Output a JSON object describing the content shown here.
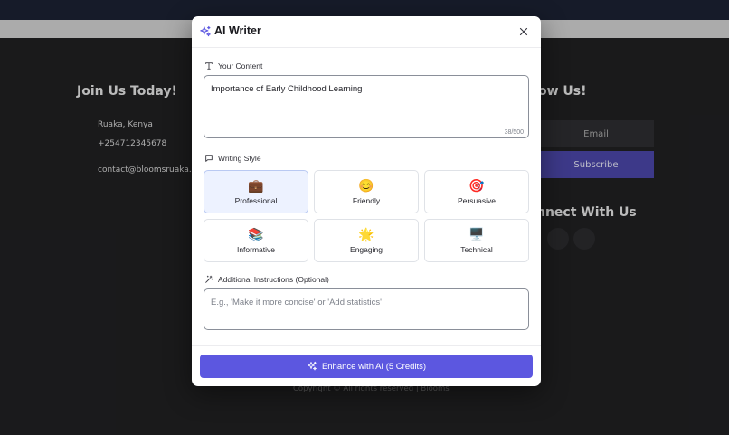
{
  "background": {
    "join_heading": "Join Us Today!",
    "location": "Ruaka, Kenya",
    "phone": "+254712345678",
    "email_link": "contact@bloomsruaka.co",
    "follow_heading": "ow Us!",
    "email_placeholder": "Email",
    "subscribe_label": "Subscribe",
    "connect_heading": "nnect With Us",
    "copyright": "Copyright © All rights reserved | Blooms"
  },
  "modal": {
    "title": "AI Writer",
    "title_icon": "sparkles-icon",
    "close_icon": "close-icon",
    "content_section": {
      "label": "Your Content",
      "icon": "text-icon",
      "value": "Importance of Early Childhood Learning",
      "char_count": "38/500"
    },
    "style_section": {
      "label": "Writing Style",
      "icon": "message-square-icon",
      "selected": "Professional",
      "styles": [
        {
          "emoji": "💼",
          "name": "Professional"
        },
        {
          "emoji": "😊",
          "name": "Friendly"
        },
        {
          "emoji": "🎯",
          "name": "Persuasive"
        },
        {
          "emoji": "📚",
          "name": "Informative"
        },
        {
          "emoji": "🌟",
          "name": "Engaging"
        },
        {
          "emoji": "🖥️",
          "name": "Technical"
        }
      ]
    },
    "instructions_section": {
      "label": "Additional Instructions (Optional)",
      "icon": "magic-wand-icon",
      "placeholder": "E.g., 'Make it more concise' or 'Add statistics'"
    },
    "enhance_button": {
      "label": "Enhance with AI (5 Credits)",
      "icon": "sparkles-icon"
    }
  },
  "colors": {
    "accent": "#5c57e0",
    "selected_card_bg": "#edf2ff",
    "footer_bg": "#202022",
    "subscribe_bg": "#4b46a8"
  }
}
